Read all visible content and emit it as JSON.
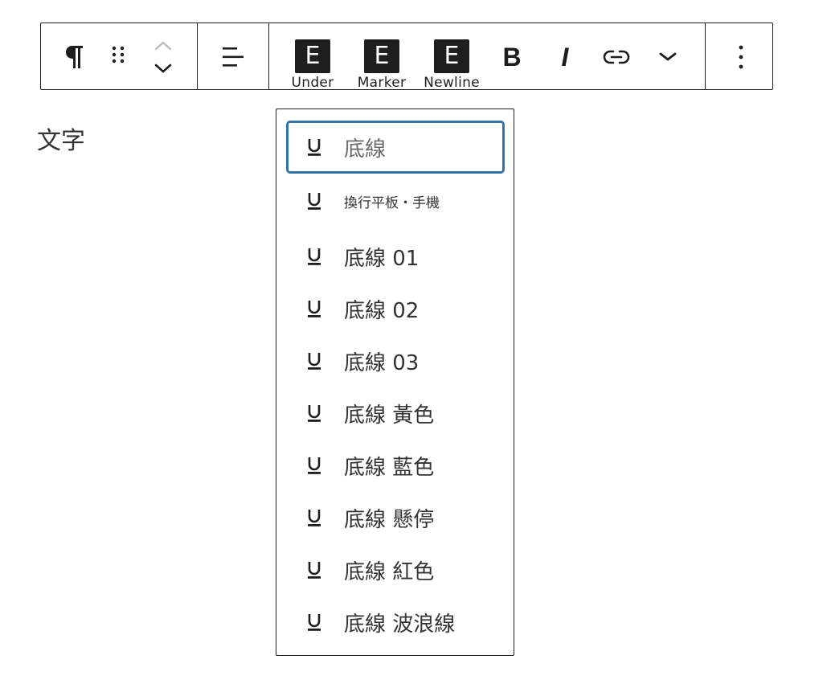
{
  "toolbar": {
    "block_type_icon": "pilcrow-icon",
    "drag_icon": "drag-handle-icon",
    "move_up_icon": "chevron-up-icon",
    "move_down_icon": "chevron-down-icon",
    "align_icon": "align-left-icon",
    "style_buttons": [
      {
        "icon_letter": "E",
        "label": "Under"
      },
      {
        "icon_letter": "E",
        "label": "Marker"
      },
      {
        "icon_letter": "E",
        "label": "Newline"
      }
    ],
    "bold_label": "B",
    "italic_label": "I",
    "link_icon": "link-icon",
    "more_icon": "chevron-down-icon",
    "options_icon": "more-vertical-icon"
  },
  "editor": {
    "paragraph_text": "文字"
  },
  "dropdown": {
    "item_icon": "underline-icon",
    "items": [
      {
        "label": "底線"
      },
      {
        "label": "換行平板・手機"
      },
      {
        "label": "底線 01"
      },
      {
        "label": "底線 02"
      },
      {
        "label": "底線 03"
      },
      {
        "label": "底線 黃色"
      },
      {
        "label": "底線 藍色"
      },
      {
        "label": "底線 懸停"
      },
      {
        "label": "底線 紅色"
      },
      {
        "label": "底線 波浪線"
      }
    ]
  },
  "colors": {
    "text": "#1e1e1e",
    "focus_ring": "#3473a8",
    "button_bg": "#1e1e1e"
  }
}
